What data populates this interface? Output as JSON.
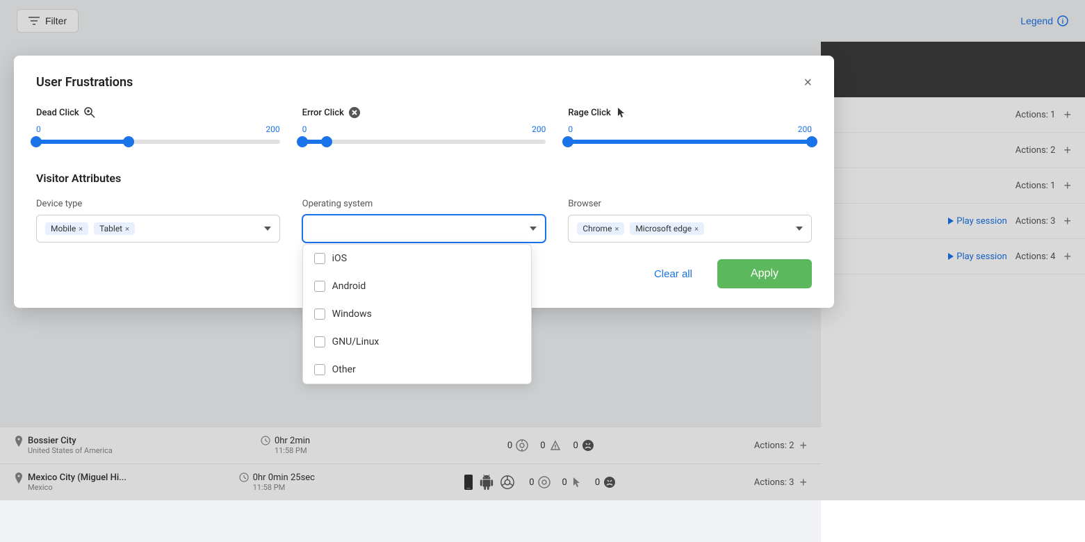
{
  "topbar": {
    "filter_label": "Filter",
    "legend_label": "Legend"
  },
  "modal": {
    "title": "User Frustrations",
    "close_label": "×",
    "sections": {
      "frustrations": {
        "items": [
          {
            "label": "Dead Click",
            "icon": "search-x-icon",
            "min": "0",
            "max": "200",
            "fill_start": 0,
            "fill_end": 38,
            "thumb1": 0,
            "thumb2": 38
          },
          {
            "label": "Error Click",
            "icon": "error-x-icon",
            "min": "0",
            "max": "200",
            "fill_start": 0,
            "fill_end": 12,
            "thumb1": 0,
            "thumb2": 12
          },
          {
            "label": "Rage Click",
            "icon": "cursor-icon",
            "min": "0",
            "max": "200",
            "fill_start": 0,
            "fill_end": 100,
            "thumb1": 0,
            "thumb2": 100
          }
        ]
      },
      "visitor_attributes": {
        "title": "Visitor Attributes",
        "device_type": {
          "label": "Device type",
          "tags": [
            "Mobile",
            "Tablet"
          ],
          "placeholder": ""
        },
        "operating_system": {
          "label": "Operating system",
          "tags": [],
          "placeholder": "",
          "options": [
            "iOS",
            "Android",
            "Windows",
            "GNU/Linux",
            "Other"
          ]
        },
        "browser": {
          "label": "Browser",
          "tags": [
            "Chrome",
            "Microsoft edge"
          ],
          "placeholder": ""
        }
      }
    },
    "footer": {
      "clear_all_label": "Clear all",
      "apply_label": "Apply"
    }
  },
  "right_panel": {
    "sessions": [
      {
        "actions_label": "Actions: 1",
        "has_play": false
      },
      {
        "actions_label": "Actions: 2",
        "has_play": false
      },
      {
        "actions_label": "Actions: 1",
        "has_play": false
      },
      {
        "actions_label": "Actions: 3",
        "has_play": true,
        "play_label": "Play session"
      },
      {
        "actions_label": "Actions: 4",
        "has_play": true,
        "play_label": "Play session"
      }
    ]
  },
  "bottom_rows": [
    {
      "city": "Bossier City",
      "country": "United States of America",
      "duration": "0hr 2min",
      "time": "11:58 PM",
      "dead_clicks": "0",
      "error_clicks": "0",
      "rage_clicks": "0",
      "actions_label": "Actions: 2",
      "has_devices": false
    },
    {
      "city": "Mexico City (Miguel Hi...",
      "country": "Mexico",
      "duration": "0hr 0min 25sec",
      "time": "11:58 PM",
      "dead_clicks": "0",
      "error_clicks": "0",
      "rage_clicks": "0",
      "actions_label": "Actions: 3",
      "has_devices": true
    }
  ]
}
